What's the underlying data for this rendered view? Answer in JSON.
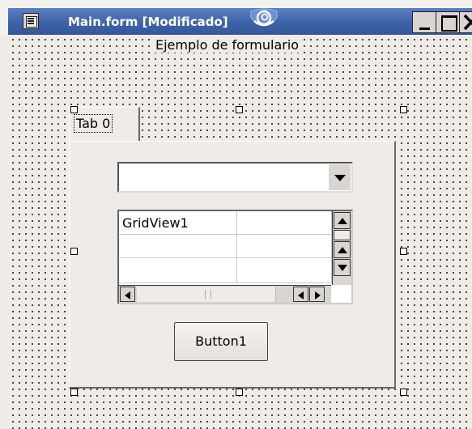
{
  "window": {
    "title": "Main.form [Modificado]",
    "buttons": [
      "minimize",
      "maximize",
      "close"
    ]
  },
  "form": {
    "label": "Ejemplo de formulario",
    "tabs": [
      {
        "label": "Tab 0",
        "selected": true
      }
    ],
    "combo": {
      "value": ""
    },
    "gridview": {
      "cells": [
        [
          "GridView1",
          ""
        ],
        [
          "",
          ""
        ],
        [
          "",
          ""
        ]
      ]
    },
    "button": {
      "label": "Button1"
    }
  },
  "icons": {
    "window_menu": "window-menu-icon",
    "app_logo": "swirl-logo-icon"
  },
  "colors": {
    "titlebar": "#3f63a8",
    "surface": "#efebe7",
    "grid_dots": "#2a2a2a"
  }
}
